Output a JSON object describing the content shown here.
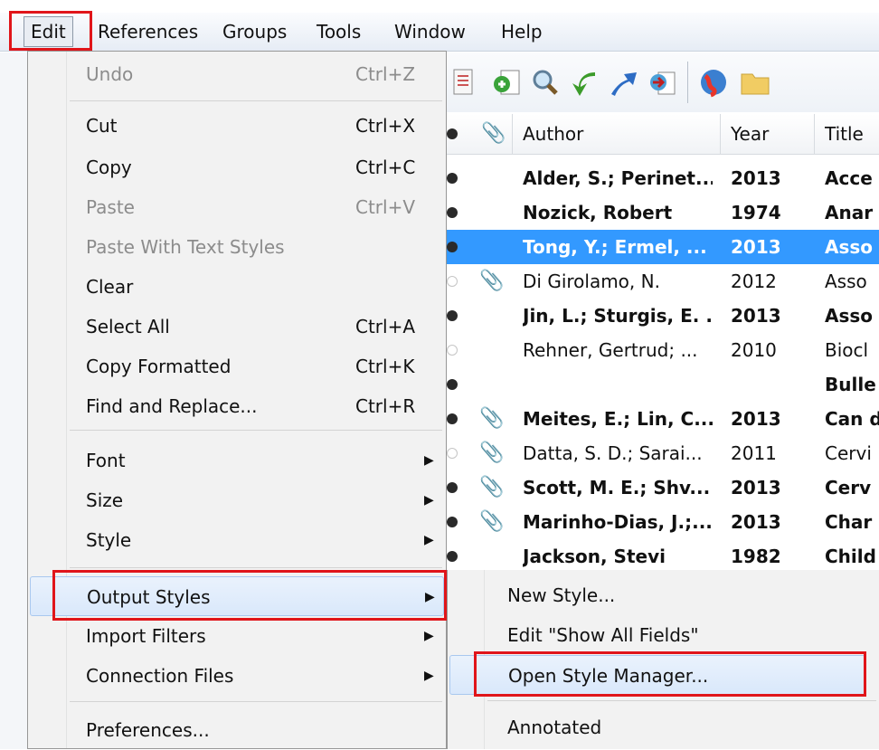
{
  "menubar": {
    "items": [
      "Edit",
      "References",
      "Groups",
      "Tools",
      "Window",
      "Help"
    ]
  },
  "toolbar": {
    "icons": [
      "new-reference-icon",
      "insert-citation-icon",
      "find-icon",
      "back-arrow-icon",
      "upload-icon",
      "export-icon",
      "globe-icon",
      "folder-icon"
    ]
  },
  "table": {
    "headers": {
      "author": "Author",
      "year": "Year",
      "title": "Title"
    },
    "rows": [
      {
        "author": "Alder, S.; Perinet...",
        "year": "2013",
        "title": "Acce",
        "bold": true,
        "read": false,
        "clip": false,
        "selected": false
      },
      {
        "author": "Nozick, Robert",
        "year": "1974",
        "title": "Anar",
        "bold": true,
        "read": false,
        "clip": false,
        "selected": false
      },
      {
        "author": "Tong, Y.; Ermel, ...",
        "year": "2013",
        "title": "Asso",
        "bold": true,
        "read": false,
        "clip": false,
        "selected": true
      },
      {
        "author": "Di Girolamo, N.",
        "year": "2012",
        "title": "Asso",
        "bold": false,
        "read": true,
        "clip": true,
        "selected": false
      },
      {
        "author": "Jin, L.; Sturgis, E. ...",
        "year": "2013",
        "title": "Asso",
        "bold": true,
        "read": false,
        "clip": false,
        "selected": false
      },
      {
        "author": "Rehner, Gertrud; ...",
        "year": "2010",
        "title": "Biocl",
        "bold": false,
        "read": true,
        "clip": false,
        "selected": false
      },
      {
        "author": "",
        "year": "",
        "title": "Bulle",
        "bold": true,
        "read": false,
        "clip": false,
        "selected": false
      },
      {
        "author": "Meites, E.; Lin, C....",
        "year": "2013",
        "title": "Can d",
        "bold": true,
        "read": false,
        "clip": true,
        "selected": false
      },
      {
        "author": "Datta, S. D.; Sarai...",
        "year": "2011",
        "title": "Cervi",
        "bold": false,
        "read": true,
        "clip": true,
        "selected": false
      },
      {
        "author": "Scott, M. E.; Shv...",
        "year": "2013",
        "title": "Cerv",
        "bold": true,
        "read": false,
        "clip": true,
        "selected": false
      },
      {
        "author": "Marinho-Dias, J.;...",
        "year": "2013",
        "title": "Char",
        "bold": true,
        "read": false,
        "clip": true,
        "selected": false
      },
      {
        "author": "Jackson, Stevi",
        "year": "1982",
        "title": "Child",
        "bold": true,
        "read": false,
        "clip": false,
        "selected": false
      }
    ]
  },
  "edit_menu": {
    "items": [
      {
        "label": "Undo",
        "shortcut": "Ctrl+Z",
        "disabled": true
      },
      {
        "label": "Cut",
        "shortcut": "Ctrl+X",
        "disabled": false
      },
      {
        "label": "Copy",
        "shortcut": "Ctrl+C",
        "disabled": false
      },
      {
        "label": "Paste",
        "shortcut": "Ctrl+V",
        "disabled": true
      },
      {
        "label": "Paste With Text Styles",
        "shortcut": "",
        "disabled": true
      },
      {
        "label": "Clear",
        "shortcut": "",
        "disabled": false
      },
      {
        "label": "Select All",
        "shortcut": "Ctrl+A",
        "disabled": false
      },
      {
        "label": "Copy Formatted",
        "shortcut": "Ctrl+K",
        "disabled": false
      },
      {
        "label": "Find and Replace...",
        "shortcut": "Ctrl+R",
        "disabled": false
      },
      {
        "label": "Font",
        "submenu": true
      },
      {
        "label": "Size",
        "submenu": true
      },
      {
        "label": "Style",
        "submenu": true
      },
      {
        "label": "Output Styles",
        "submenu": true,
        "highlighted": true
      },
      {
        "label": "Import Filters",
        "submenu": true
      },
      {
        "label": "Connection Files",
        "submenu": true
      },
      {
        "label": "Preferences..."
      }
    ]
  },
  "output_styles_submenu": {
    "items": [
      {
        "label": "New Style..."
      },
      {
        "label": "Edit \"Show All Fields\""
      },
      {
        "label": "Open Style Manager...",
        "highlighted": true
      },
      {
        "label": "Annotated"
      }
    ]
  },
  "colors": {
    "selection": "#3399ff",
    "annotation_red": "#e0151a",
    "menu_bg": "#f2f2f2"
  }
}
